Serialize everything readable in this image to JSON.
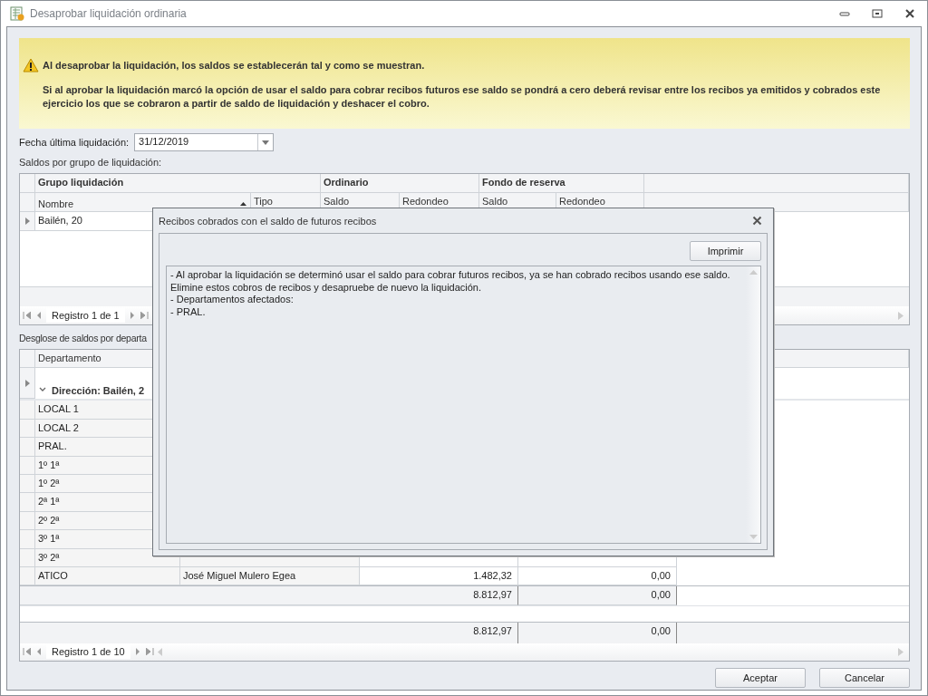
{
  "window": {
    "title": "Desaprobar liquidación ordinaria"
  },
  "warning": {
    "heading": "Al desaprobar la liquidación, los saldos se establecerán tal y como se muestran.",
    "body": "Si al aprobar la liquidación marcó la opción de usar el saldo para cobrar recibos futuros ese saldo se pondrá a cero deberá revisar entre los recibos ya emitidos y cobrados este ejercicio los que se cobraron a partir de saldo de liquidación y deshacer el cobro."
  },
  "date_field": {
    "label": "Fecha última liquidación:",
    "value": "31/12/2019"
  },
  "groups_grid": {
    "label": "Saldos por grupo de liquidación:",
    "bands": [
      "Grupo liquidación",
      "Ordinario",
      "Fondo de reserva"
    ],
    "columns": [
      "Nombre",
      "Tipo",
      "Saldo",
      "Redondeo",
      "Saldo",
      "Redondeo"
    ],
    "rows": [
      {
        "name": "Bailén, 20",
        "current": true
      }
    ],
    "navigator": "Registro 1 de 1"
  },
  "departments_grid": {
    "label": "Desglose de saldos por departa",
    "columns": [
      "Departamento"
    ],
    "group": {
      "label": "Dirección: Bailén, 2",
      "expanded": true,
      "current": true
    },
    "rows": [
      {
        "department": "LOCAL 1"
      },
      {
        "department": "LOCAL 2"
      },
      {
        "department": "PRAL."
      },
      {
        "department": "1º 1ª"
      },
      {
        "department": "1º 2ª"
      },
      {
        "department": "2ª 1ª"
      },
      {
        "department": "2º 2ª"
      },
      {
        "department": "3º 1ª"
      },
      {
        "department": "3º 2ª"
      },
      {
        "department": "ATICO",
        "owner": "José Miguel Mulero Egea",
        "saldo": "1.482,32",
        "redondeo": "0,00"
      }
    ],
    "group_footer": [
      "8.812,97",
      "0,00"
    ],
    "total_footer": [
      "8.812,97",
      "0,00"
    ],
    "navigator": "Registro 1 de 10"
  },
  "dialog": {
    "title": "Recibos cobrados con el saldo de futuros recibos",
    "print_button": "Imprimir",
    "lines": [
      "- Al aprobar la liquidación se determinó usar el saldo para cobrar futuros recibos, ya se han cobrado recibos usando ese saldo.",
      "Elimine estos cobros de recibos y desapruebe de nuevo la liquidación.",
      "- Departamentos afectados:",
      "- PRAL."
    ]
  },
  "buttons": [
    "Aceptar",
    "Cancelar"
  ]
}
